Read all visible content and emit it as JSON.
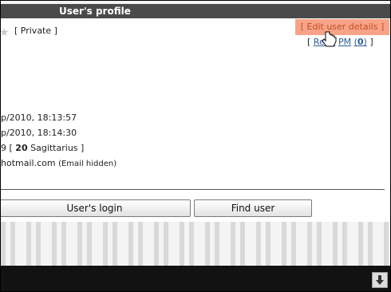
{
  "header": {
    "title": "User's profile"
  },
  "profile": {
    "private_label": "[ Private ]",
    "edit_button": "[ Edit user details ]",
    "pm_links": {
      "open_bracket": "[",
      "read_label": "Read",
      "pm_label": "PM",
      "pm_count_open": "(",
      "pm_count": "0",
      "pm_count_close": ")",
      "close_bracket": "]"
    },
    "registered": "p/2010, 18:13:57",
    "last_visit": "p/2010, 18:14:30",
    "age_prefix": "9 [",
    "age": "20",
    "sign": "Sagittarius ]",
    "email_fragment": "hotmail.com",
    "email_hidden": "(Email hidden)"
  },
  "buttons": {
    "login": "User's login",
    "find": "Find user"
  }
}
